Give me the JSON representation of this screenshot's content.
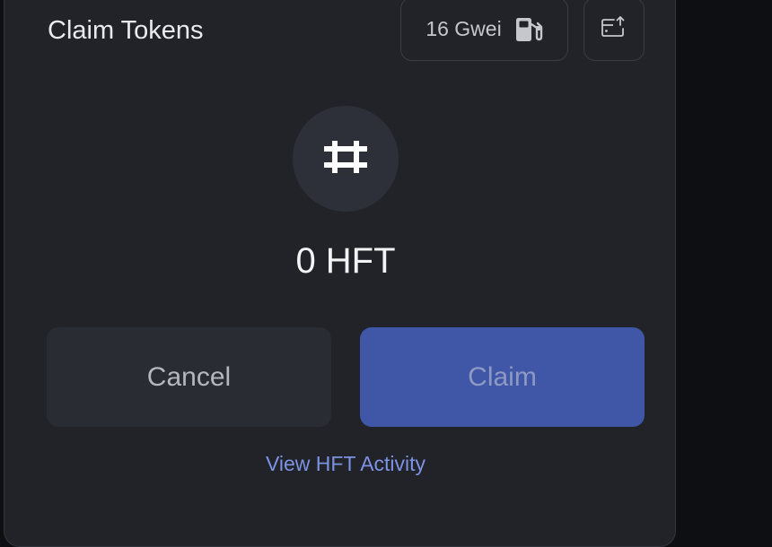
{
  "modal": {
    "title": "Claim Tokens",
    "gas": {
      "label": "16 Gwei",
      "icon": "gas-pump-icon"
    },
    "export_icon": "wallet-export-icon"
  },
  "token": {
    "icon": "hashflow-icon",
    "amount": "0 HFT"
  },
  "actions": {
    "cancel_label": "Cancel",
    "claim_label": "Claim"
  },
  "footer": {
    "activity_link": "View HFT Activity"
  },
  "colors": {
    "background": "#212328",
    "accent": "#4056a6",
    "link": "#7e92e3"
  }
}
